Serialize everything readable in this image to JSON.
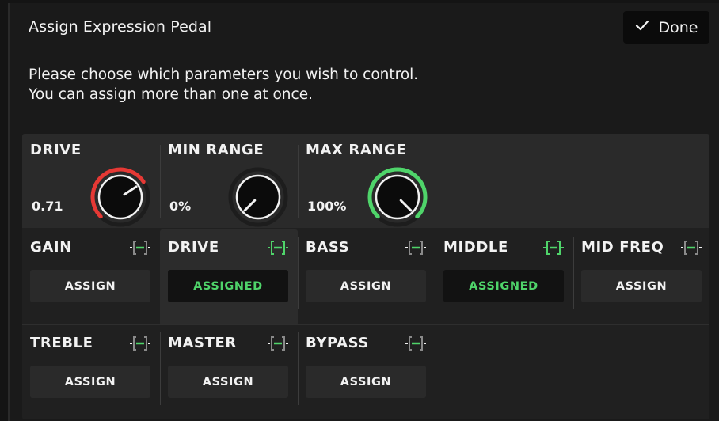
{
  "dialog": {
    "title": "Assign Expression Pedal",
    "done_label": "Done",
    "description_line1": "Please choose which parameters you wish to control.",
    "description_line2": "You can assign more than one at once."
  },
  "knobs": [
    {
      "label": "DRIVE",
      "value": "0.71",
      "arc_color": "#e53935",
      "level": 0.71
    },
    {
      "label": "MIN RANGE",
      "value": "0%",
      "arc_color": "#3a3a3a",
      "level": 0.0
    },
    {
      "label": "MAX RANGE",
      "value": "100%",
      "arc_color": "#4fd46a",
      "level": 1.0
    }
  ],
  "params": [
    {
      "name": "GAIN",
      "button": "ASSIGN",
      "assigned": false
    },
    {
      "name": "DRIVE",
      "button": "ASSIGNED",
      "assigned": true
    },
    {
      "name": "BASS",
      "button": "ASSIGN",
      "assigned": false
    },
    {
      "name": "MIDDLE",
      "button": "ASSIGNED",
      "assigned": true
    },
    {
      "name": "MID FREQ",
      "button": "ASSIGN",
      "assigned": false
    },
    {
      "name": "TREBLE",
      "button": "ASSIGN",
      "assigned": false
    },
    {
      "name": "MASTER",
      "button": "ASSIGN",
      "assigned": false
    },
    {
      "name": "BYPASS",
      "button": "ASSIGN",
      "assigned": false
    }
  ],
  "colors": {
    "accent_green": "#4fd46a",
    "drive_red": "#e53935",
    "icon_gray": "#8a8a8a",
    "background": "#1a1a1a"
  },
  "icons": {
    "done": "checkmark-icon",
    "param": "expression-bracket-icon"
  }
}
